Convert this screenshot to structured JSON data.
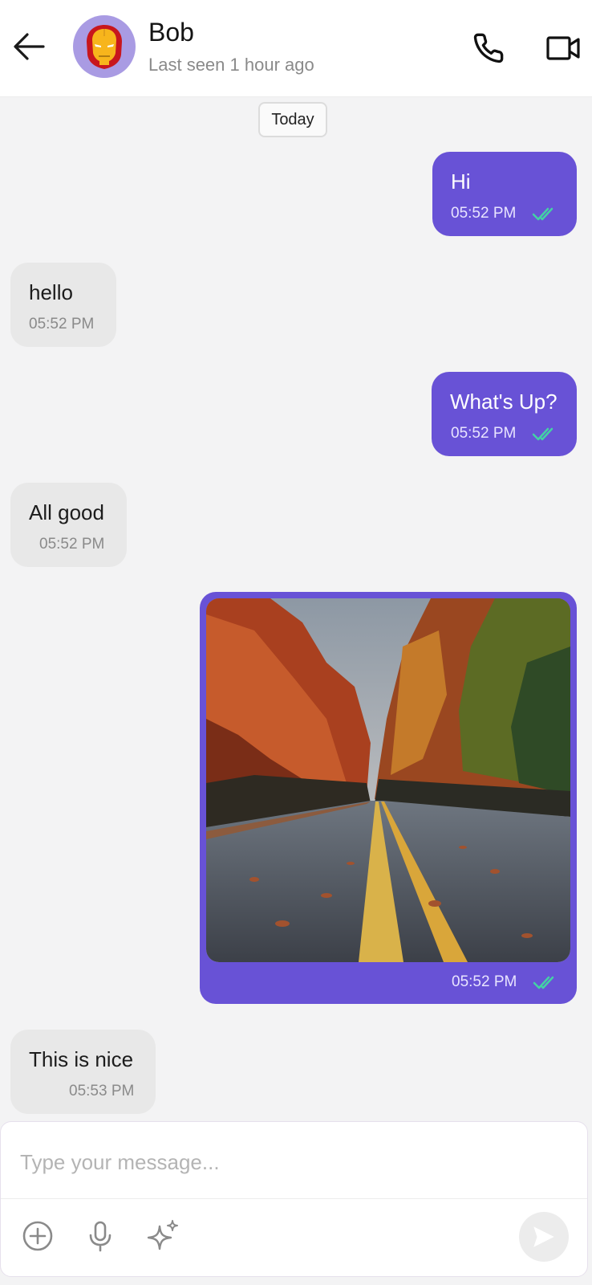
{
  "header": {
    "contact_name": "Bob",
    "status": "Last seen 1 hour ago",
    "back_icon": "arrow-left-icon",
    "call_icon": "phone-icon",
    "video_icon": "video-camera-icon",
    "avatar_icon": "iron-man-mask-icon"
  },
  "date_separator": "Today",
  "messages": [
    {
      "direction": "outgoing",
      "text": "Hi",
      "time": "05:52 PM",
      "read": true
    },
    {
      "direction": "incoming",
      "text": "hello",
      "time": "05:52 PM"
    },
    {
      "direction": "outgoing",
      "text": "What's Up?",
      "time": "05:52 PM",
      "read": true
    },
    {
      "direction": "incoming",
      "text": "All good",
      "time": "05:52 PM"
    },
    {
      "direction": "outgoing",
      "type": "image",
      "image": "autumn-road-photo",
      "time": "05:52 PM",
      "read": true
    },
    {
      "direction": "incoming",
      "text": "This is nice",
      "time": "05:53 PM"
    }
  ],
  "composer": {
    "placeholder": "Type your message...",
    "add_icon": "plus-circle-icon",
    "mic_icon": "microphone-icon",
    "ai_icon": "sparkle-icon",
    "send_icon": "send-icon"
  },
  "colors": {
    "accent": "#6852d6",
    "incoming_bubble": "#e8e8e8",
    "background": "#f3f3f4",
    "read_ticks": "#43d1a5",
    "avatar_bg": "#a99be3"
  }
}
